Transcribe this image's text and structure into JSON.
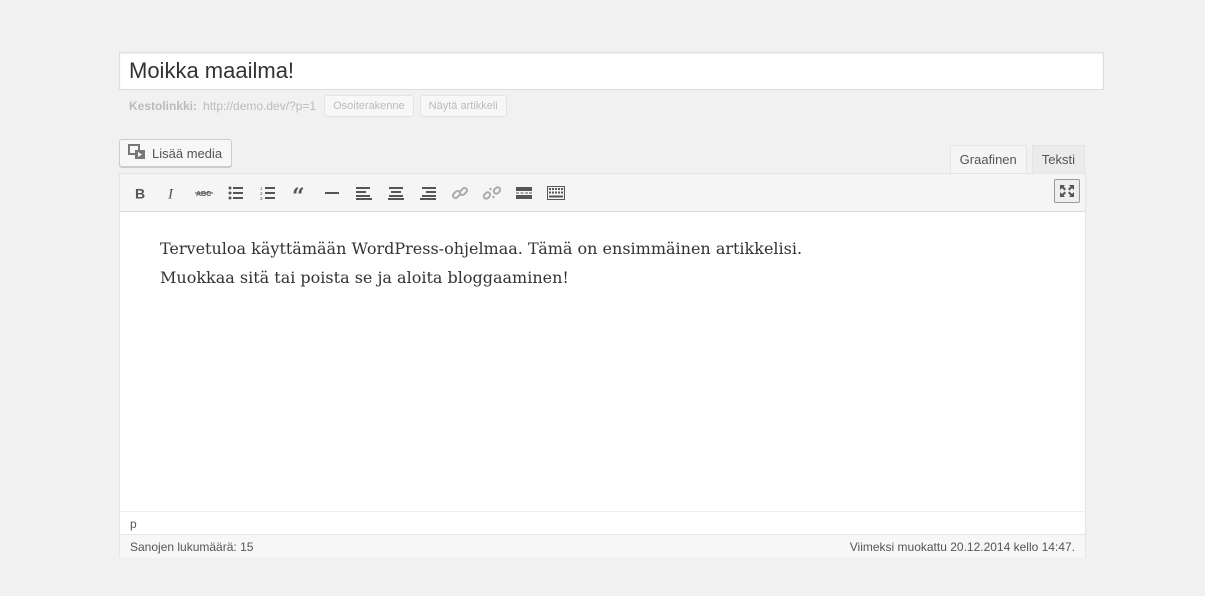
{
  "post": {
    "title": "Moikka maailma!"
  },
  "permalink": {
    "label": "Kestolinkki:",
    "url": "http://demo.dev/?p=1",
    "button_edit": "Osoiterakenne",
    "button_view": "Näytä artikkeli"
  },
  "media": {
    "add_label": "Lisää media"
  },
  "tabs": {
    "visual": "Graafinen",
    "text": "Teksti"
  },
  "toolbar": {
    "icons": [
      "bold-icon",
      "italic-icon",
      "strikethrough-icon",
      "bullet-list-icon",
      "numbered-list-icon",
      "blockquote-icon",
      "horizontal-rule-icon",
      "align-left-icon",
      "align-center-icon",
      "align-right-icon",
      "link-icon",
      "unlink-icon",
      "read-more-icon",
      "toolbar-toggle-icon",
      "fullscreen-icon"
    ]
  },
  "content": {
    "line1": "Tervetuloa käyttämään WordPress-ohjelmaa. Tämä on ensimmäinen artikkelisi.",
    "line2": "Muokkaa sitä tai poista se ja aloita bloggaaminen!"
  },
  "path": "p",
  "status": {
    "word_count": "Sanojen lukumäärä: 15",
    "last_edited": "Viimeksi muokattu 20.12.2014 kello 14:47."
  }
}
